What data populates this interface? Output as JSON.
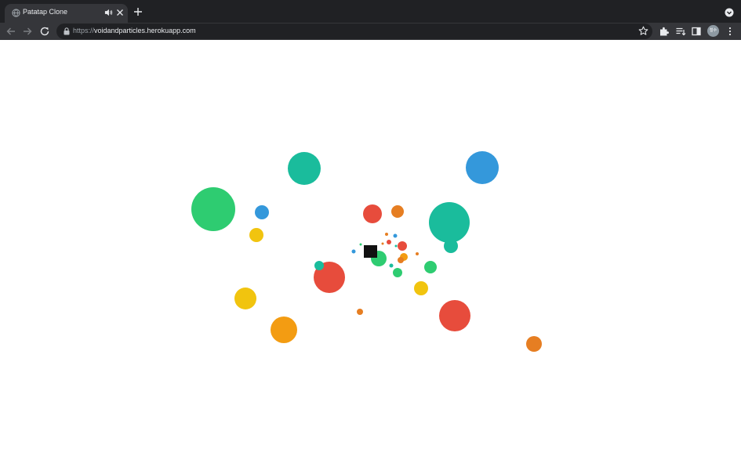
{
  "tab": {
    "title": "Patatap Clone",
    "favicon_icon": "globe-icon",
    "audio_icon": "speaker-icon",
    "close_icon": "close-icon"
  },
  "toolbar": {
    "new_tab_icon": "plus-icon",
    "tab_search_icon": "chevron-down-icon",
    "back_icon": "arrow-left-icon",
    "forward_icon": "arrow-right-icon",
    "reload_icon": "reload-icon",
    "lock_icon": "lock-icon",
    "url_scheme": "https://",
    "url_host": "voidandparticles.herokuapp.com",
    "bookmark_icon": "star-icon",
    "extensions_icon": "puzzle-icon",
    "reading_list_icon": "reading-list-icon",
    "side_panel_icon": "side-panel-icon",
    "avatar_text": "철수"
  },
  "colors": {
    "tabstrip": "#202124",
    "toolbar": "#35363a",
    "page_bg": "#ffffff",
    "red": "#e74c3c",
    "orange": "#e67e22",
    "yellow": "#f1c40f",
    "gold": "#f39c12",
    "green": "#2ecc71",
    "teal": "#1abc9c",
    "blue": "#3498db"
  }
}
